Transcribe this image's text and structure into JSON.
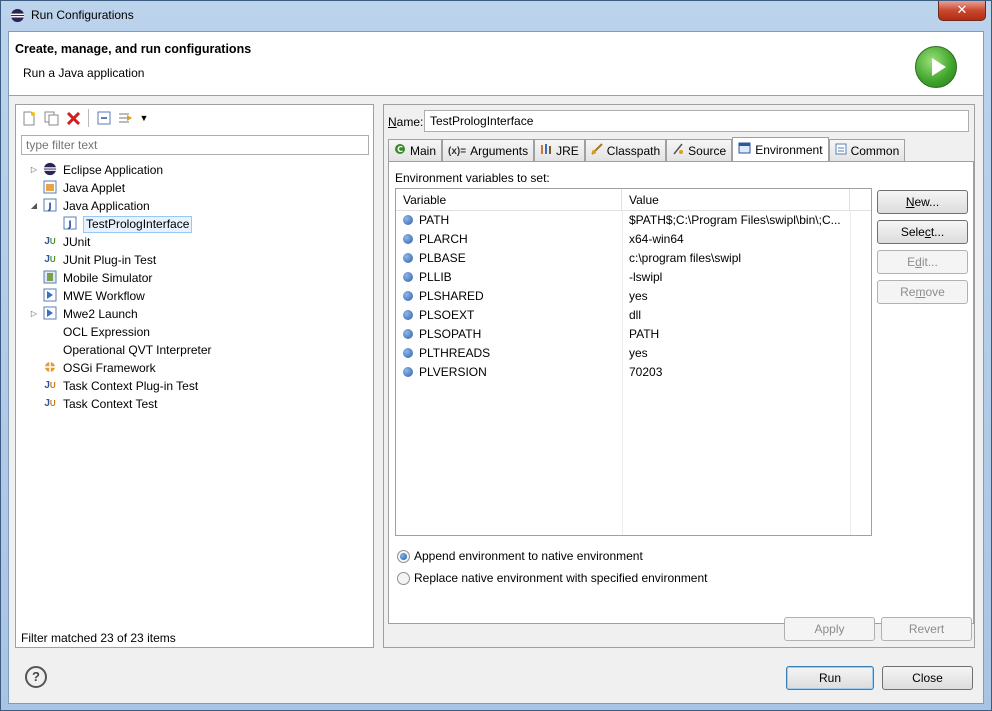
{
  "window": {
    "title": "Run Configurations",
    "close_glyph": "✕"
  },
  "header": {
    "title": "Create, manage, and run configurations",
    "subtitle": "Run a Java application"
  },
  "left_panel": {
    "toolbar_icons": [
      "new-config-icon",
      "duplicate-icon",
      "delete-icon",
      "collapse-all-icon",
      "filter-icon",
      "dropdown-icon"
    ],
    "filter_placeholder": "type filter text",
    "tree": [
      {
        "label": "Eclipse Application",
        "icon": "eclipse-icon",
        "twisty": "collapsed",
        "level": 0
      },
      {
        "label": "Java Applet",
        "icon": "java-applet-icon",
        "twisty": "",
        "level": 0
      },
      {
        "label": "Java Application",
        "icon": "java-application-icon",
        "twisty": "expanded",
        "level": 0
      },
      {
        "label": "TestPrologInterface",
        "icon": "java-application-icon",
        "twisty": "",
        "level": 1,
        "selected": true
      },
      {
        "label": "JUnit",
        "icon": "junit-icon",
        "twisty": "",
        "level": 0
      },
      {
        "label": "JUnit Plug-in Test",
        "icon": "junit-plugin-icon",
        "twisty": "",
        "level": 0
      },
      {
        "label": "Mobile Simulator",
        "icon": "mobile-simulator-icon",
        "twisty": "",
        "level": 0
      },
      {
        "label": "MWE Workflow",
        "icon": "mwe-workflow-icon",
        "twisty": "",
        "level": 0
      },
      {
        "label": "Mwe2 Launch",
        "icon": "mwe2-launch-icon",
        "twisty": "collapsed",
        "level": 0
      },
      {
        "label": "OCL Expression",
        "icon": "",
        "twisty": "",
        "level": 0
      },
      {
        "label": "Operational QVT Interpreter",
        "icon": "",
        "twisty": "",
        "level": 0
      },
      {
        "label": "OSGi Framework",
        "icon": "osgi-icon",
        "twisty": "",
        "level": 0
      },
      {
        "label": "Task Context Plug-in Test",
        "icon": "task-context-plugin-icon",
        "twisty": "",
        "level": 0
      },
      {
        "label": "Task Context Test",
        "icon": "task-context-icon",
        "twisty": "",
        "level": 0
      }
    ],
    "filter_status": "Filter matched 23 of 23 items"
  },
  "right_panel": {
    "name_label": "Name:",
    "name_value": "TestPrologInterface",
    "tabs": [
      {
        "label": "Main",
        "icon": "main-icon"
      },
      {
        "label": "Arguments",
        "icon": "arguments-icon",
        "glyph": "(x)="
      },
      {
        "label": "JRE",
        "icon": "jre-icon"
      },
      {
        "label": "Classpath",
        "icon": "classpath-icon"
      },
      {
        "label": "Source",
        "icon": "source-icon"
      },
      {
        "label": "Environment",
        "icon": "environment-icon",
        "active": true
      },
      {
        "label": "Common",
        "icon": "common-icon"
      }
    ],
    "env_label": "Environment variables to set:",
    "table": {
      "columns": [
        "Variable",
        "Value"
      ],
      "rows": [
        {
          "variable": "PATH",
          "value": "$PATH$;C:\\Program Files\\swipl\\bin\\;C..."
        },
        {
          "variable": "PLARCH",
          "value": "x64-win64"
        },
        {
          "variable": "PLBASE",
          "value": "c:\\program files\\swipl"
        },
        {
          "variable": "PLLIB",
          "value": "-lswipl"
        },
        {
          "variable": "PLSHARED",
          "value": "yes"
        },
        {
          "variable": "PLSOEXT",
          "value": "dll"
        },
        {
          "variable": "PLSOPATH",
          "value": "PATH"
        },
        {
          "variable": "PLTHREADS",
          "value": "yes"
        },
        {
          "variable": "PLVERSION",
          "value": "70203"
        }
      ]
    },
    "side_buttons": {
      "new": "New...",
      "select": "Select...",
      "edit": "Edit...",
      "remove": "Remove"
    },
    "radios": {
      "append": "Append environment to native environment",
      "replace": "Replace native environment with specified environment",
      "selected": "append"
    },
    "apply": "Apply",
    "revert": "Revert"
  },
  "footer": {
    "help_glyph": "?",
    "run": "Run",
    "close": "Close"
  }
}
